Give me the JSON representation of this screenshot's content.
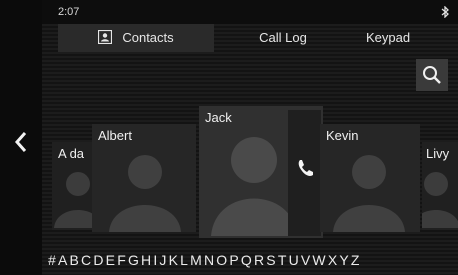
{
  "status": {
    "time": "2:07"
  },
  "tabs": [
    {
      "label": "Contacts",
      "active": true
    },
    {
      "label": "Call Log",
      "active": false
    },
    {
      "label": "Keypad",
      "active": false
    }
  ],
  "contacts": [
    {
      "name": "A da"
    },
    {
      "name": "Albert"
    },
    {
      "name": "Jack",
      "focused": true
    },
    {
      "name": "Kevin"
    },
    {
      "name": "Livy"
    }
  ],
  "alphabet": [
    "#",
    "A",
    "B",
    "C",
    "D",
    "E",
    "F",
    "G",
    "H",
    "I",
    "J",
    "K",
    "L",
    "M",
    "N",
    "O",
    "P",
    "Q",
    "R",
    "S",
    "T",
    "U",
    "V",
    "W",
    "X",
    "Y",
    "Z"
  ],
  "icons": {
    "back": "chevron-left-icon",
    "search": "search-icon",
    "call": "phone-icon",
    "bluetooth": "bluetooth-icon",
    "contacts": "contact-card-icon"
  },
  "colors": {
    "background": "#121212",
    "card_focused": "#303030",
    "text": "#eaeaea"
  }
}
